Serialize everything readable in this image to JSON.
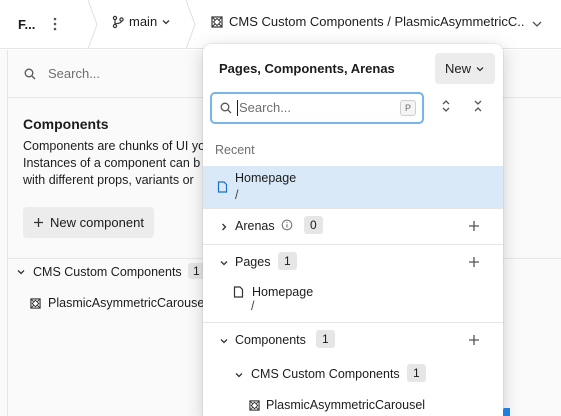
{
  "topbar": {
    "project": "F...",
    "branch": "main",
    "path": "CMS Custom Components / PlasmicAsymmetricC..."
  },
  "left_pane": {
    "search_placeholder": "Search...",
    "title": "Components",
    "description_lines": [
      "Components are chunks of UI yo",
      "Instances of a component can b",
      "with different props, variants or"
    ],
    "new_component_label": "New component",
    "group": {
      "label": "CMS Custom Components",
      "count": "1"
    },
    "item": "PlasmicAsymmetricCarousel"
  },
  "popover": {
    "title": "Pages, Components, Arenas",
    "new_label": "New",
    "search_placeholder": "Search...",
    "search_shortcut": "P",
    "recent_label": "Recent",
    "recent_item": {
      "name": "Homepage",
      "path": "/"
    },
    "arenas": {
      "label": "Arenas",
      "count": "0"
    },
    "pages": {
      "label": "Pages",
      "count": "1",
      "items": [
        {
          "name": "Homepage",
          "path": "/"
        }
      ]
    },
    "components": {
      "label": "Components",
      "count": "1",
      "group": {
        "label": "CMS Custom Components",
        "count": "1"
      },
      "item": "PlasmicAsymmetricCarousel"
    }
  },
  "colors": {
    "selected_row": "#d9e9f8",
    "focus_ring": "#78b4e6",
    "accent": "#1f7fe0"
  }
}
